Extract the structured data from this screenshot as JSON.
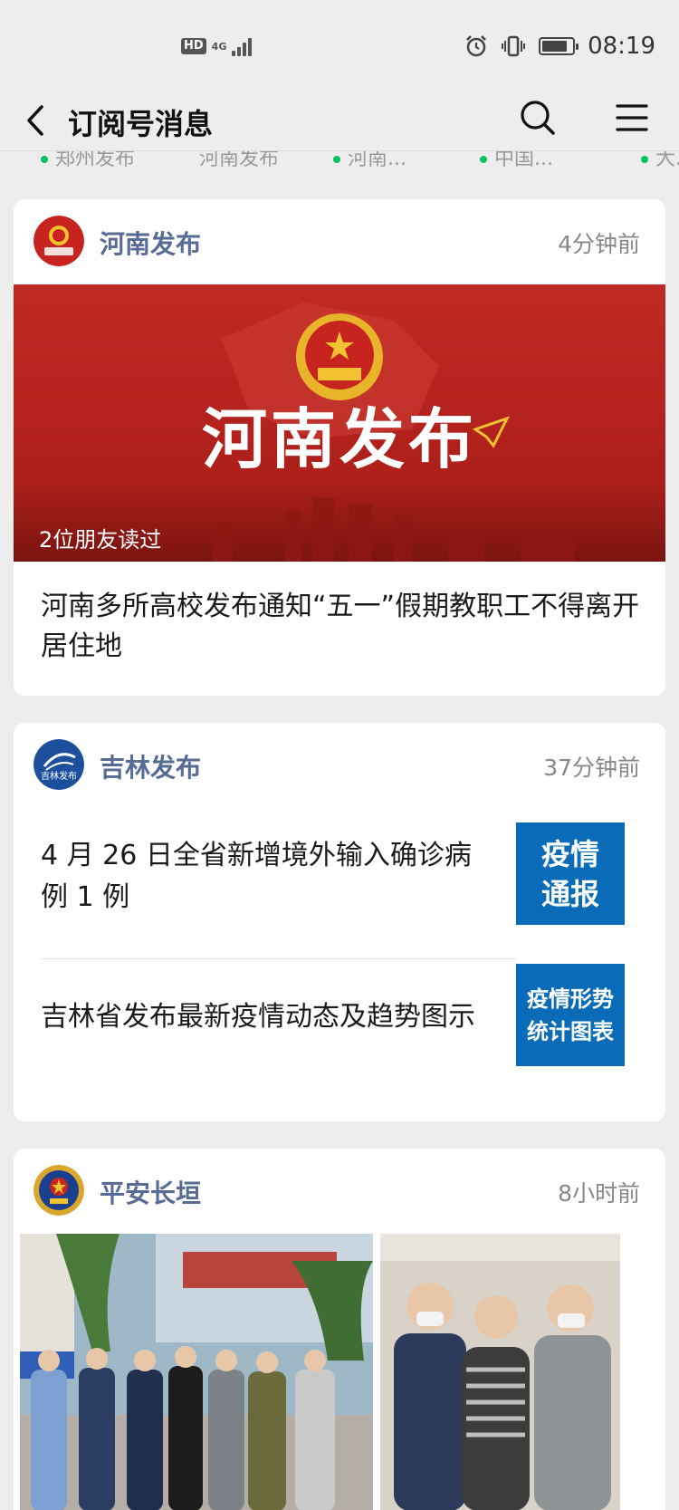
{
  "status_bar": {
    "hd_label": "HD",
    "network": "4G",
    "time": "08:19"
  },
  "nav": {
    "title": "订阅号消息"
  },
  "recent_accounts": [
    "郑州发布",
    "河南发布",
    "河南...",
    "中国...",
    "大..."
  ],
  "cards": [
    {
      "account": "河南发布",
      "time": "4分钟前",
      "banner_title": "河南发布",
      "friends_read": "2位朋友读过",
      "article_title": "河南多所高校发布通知“五一”假期教职工不得离开居住地"
    },
    {
      "account": "吉林发布",
      "time": "37分钟前",
      "avatar_text": "吉林发布",
      "articles": [
        {
          "title": "4 月 26 日全省新增境外输入确诊病例 1 例",
          "thumb": "疫情\n通报"
        },
        {
          "title": "吉林省发布最新疫情动态及趋势图示",
          "thumb": "疫情形势\n统计图表"
        }
      ]
    },
    {
      "account": "平安长垣",
      "time": "8小时前"
    }
  ],
  "colors": {
    "background": "#ededed",
    "account_name": "#576b95",
    "banner_red": "#b8221e",
    "thumb_blue": "#0a6cb8"
  },
  "icons": [
    "back-arrow-icon",
    "search-icon",
    "menu-icon",
    "alarm-icon",
    "vibrate-icon",
    "battery-icon",
    "signal-icon"
  ]
}
